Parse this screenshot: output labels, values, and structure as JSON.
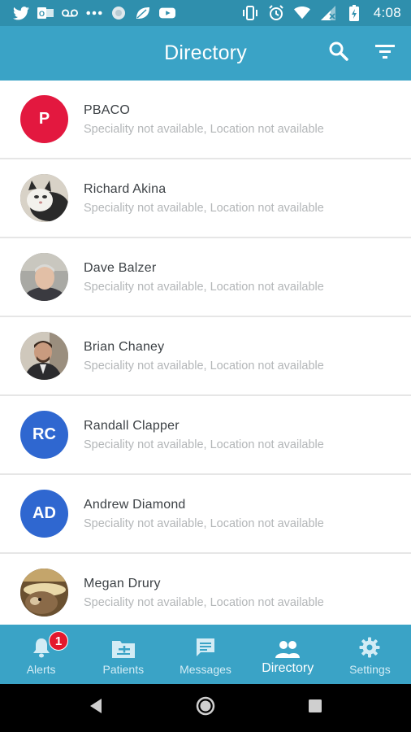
{
  "status_bar": {
    "time": "4:08",
    "left_icons": [
      "twitter-icon",
      "outlook-icon",
      "voicemail-icon",
      "more-dots-icon",
      "circle-app-icon",
      "leaf-icon",
      "youtube-icon"
    ],
    "right_icons": [
      "vibrate-icon",
      "alarm-icon",
      "wifi-icon",
      "signal-icon",
      "battery-icon"
    ]
  },
  "app_bar": {
    "title": "Directory",
    "actions": [
      "search-icon",
      "filter-icon"
    ]
  },
  "colors": {
    "status_bar": "#2f8fad",
    "primary": "#3aa3c6",
    "avatar_red": "#e3183f",
    "avatar_blue": "#2f67d0",
    "badge": "#e3182d"
  },
  "contacts": [
    {
      "name": "PBACO",
      "subtitle": "Speciality not available, Location not available",
      "avatar_type": "initials",
      "initials": "P",
      "avatar_color": "#e3183f"
    },
    {
      "name": "Richard Akina",
      "subtitle": "Speciality not available, Location not available",
      "avatar_type": "photo",
      "photo": "cat-photo"
    },
    {
      "name": "Dave Balzer",
      "subtitle": "Speciality not available, Location not available",
      "avatar_type": "photo",
      "photo": "man-gray-hair-photo"
    },
    {
      "name": "Brian Chaney",
      "subtitle": "Speciality not available, Location not available",
      "avatar_type": "photo",
      "photo": "man-suit-photo"
    },
    {
      "name": "Randall Clapper",
      "subtitle": "Speciality not available, Location not available",
      "avatar_type": "initials",
      "initials": "RC",
      "avatar_color": "#2f67d0"
    },
    {
      "name": "Andrew Diamond",
      "subtitle": "Speciality not available, Location not available",
      "avatar_type": "initials",
      "initials": "AD",
      "avatar_color": "#2f67d0"
    },
    {
      "name": "Megan Drury",
      "subtitle": "Speciality not available, Location not available",
      "avatar_type": "photo",
      "photo": "dog-photo"
    }
  ],
  "bottom_nav": {
    "items": [
      {
        "label": "Alerts",
        "icon": "bell-icon",
        "badge": "1"
      },
      {
        "label": "Patients",
        "icon": "patients-icon"
      },
      {
        "label": "Messages",
        "icon": "message-icon"
      },
      {
        "label": "Directory",
        "icon": "people-icon",
        "active": true
      },
      {
        "label": "Settings",
        "icon": "gear-icon"
      }
    ]
  },
  "system_nav": [
    "back-icon",
    "home-icon",
    "recents-icon"
  ]
}
